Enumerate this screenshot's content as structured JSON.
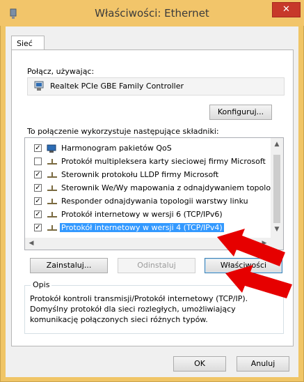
{
  "window": {
    "title": "Właściwości: Ethernet",
    "close_label": "✕"
  },
  "tabs": [
    {
      "label": "Sieć"
    }
  ],
  "connect_using": {
    "label": "Połącz, używając:",
    "adapter_name": "Realtek PCIe GBE Family Controller",
    "configure_button": "Konfiguruj..."
  },
  "components": {
    "label": "To połączenie wykorzystuje następujące składniki:",
    "items": [
      {
        "label": "Harmonogram pakietów QoS",
        "checked": true,
        "icon": "qos-scheduler-icon"
      },
      {
        "label": "Protokół multipleksera karty sieciowej firmy Microsoft",
        "checked": false,
        "icon": "network-protocol-icon"
      },
      {
        "label": "Sterownik protokołu LLDP firmy Microsoft",
        "checked": true,
        "icon": "network-protocol-icon"
      },
      {
        "label": "Sterownik We/Wy mapowania z odnajdywaniem topologii",
        "checked": true,
        "icon": "network-protocol-icon"
      },
      {
        "label": "Responder odnajdywania topologii warstwy linku",
        "checked": true,
        "icon": "network-protocol-icon"
      },
      {
        "label": "Protokół internetowy w wersji 6 (TCP/IPv6)",
        "checked": true,
        "icon": "network-protocol-icon"
      },
      {
        "label": "Protokół internetowy w wersji 4 (TCP/IPv4)",
        "checked": true,
        "icon": "network-protocol-icon",
        "selected": true
      }
    ]
  },
  "buttons": {
    "install": "Zainstaluj...",
    "uninstall": "Odinstaluj",
    "properties": "Właściwości",
    "ok": "OK",
    "cancel": "Anuluj"
  },
  "description": {
    "title": "Opis",
    "text": "Protokół kontroli transmisji/Protokół internetowy (TCP/IP). Domyślny protokół dla sieci rozległych, umożliwiający komunikację połączonych sieci różnych typów."
  },
  "colors": {
    "titlebar": "#f2c56a",
    "selection": "#3399ff",
    "close_button": "#c7382a",
    "annotation_arrow": "#e60000"
  }
}
